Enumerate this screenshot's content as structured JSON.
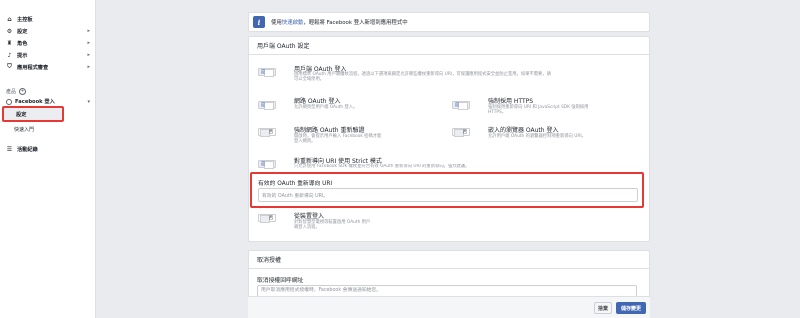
{
  "sidebar": {
    "items": [
      {
        "label": "主控板",
        "icon": "home-icon"
      },
      {
        "label": "設定",
        "icon": "gear-icon"
      },
      {
        "label": "角色",
        "icon": "roles-icon"
      },
      {
        "label": "提示",
        "icon": "bell-icon"
      },
      {
        "label": "應用程式審查",
        "icon": "shield-icon"
      }
    ],
    "products_label": "產品",
    "facebook_login": "Facebook 登入",
    "settings_label": "設定",
    "quickstart_label": "快速入門",
    "activity_log": "活動紀錄"
  },
  "info": {
    "prefix": "使用",
    "link": "快速啟動",
    "suffix": "，輕鬆將 Facebook 登入新增到應用程式中"
  },
  "oauth": {
    "header": "用戶端 OAuth 設定",
    "client_oauth": {
      "title": "用戶端 OAuth 登入",
      "desc": "啟用標準 OAuth 用戶端權杖流程，透過以下選項來鎖定允許哪些權杖重新導向 URI，可保護應用程式安全並防止濫用。如果不需要，請可以全域停用。",
      "toggle": "是"
    },
    "web_oauth": {
      "title": "網路 OAuth 登入",
      "desc": "允許網頁型用戶端 OAuth 登入。",
      "toggle": "是"
    },
    "force_https": {
      "title": "強制採用 HTTPS",
      "desc": "強制採用重新導向 URI 和 JavaScript SDK 強制採用 HTTPS。",
      "toggle": "是"
    },
    "force_reauth": {
      "title": "強制網路 OAuth 重新驗證",
      "desc": "開啟時，會提示用戶輸入 Facebook 密碼才能登入網頁。",
      "toggle": "否"
    },
    "embedded_browser": {
      "title": "嵌入的瀏覽器 OAuth 登入",
      "desc": "允許用戶端 OAuth 的瀏覽器控制項重新導向 URI。",
      "toggle": "否"
    },
    "strict_mode": {
      "title": "對重新導向 URI 使用 Strict 模式",
      "desc": "只允許使用 Facebook SDK 權杖並符合有效 OAuth 重新導向 URI 的重新導向。強烈建議。",
      "toggle": "是"
    },
    "redirect_uri": {
      "label": "有效的 OAuth 重新導向 URI",
      "placeholder": "有效的 OAuth 重新導向 URI。"
    },
    "device_login": {
      "title": "從裝置登入",
      "desc": "針對智慧型電視等裝置啟用 OAuth 用戶端登入流程。",
      "toggle": "否"
    }
  },
  "deauth": {
    "header": "取消授權",
    "callback_label": "取消授權回呼網址",
    "placeholder": "用戶取消應用程式授權時，Facebook 會傳送通知給您。"
  },
  "footer": {
    "discard": "捨棄",
    "save": "儲存變更"
  },
  "colors": {
    "accent": "#4267b2",
    "highlight": "#e53935"
  }
}
